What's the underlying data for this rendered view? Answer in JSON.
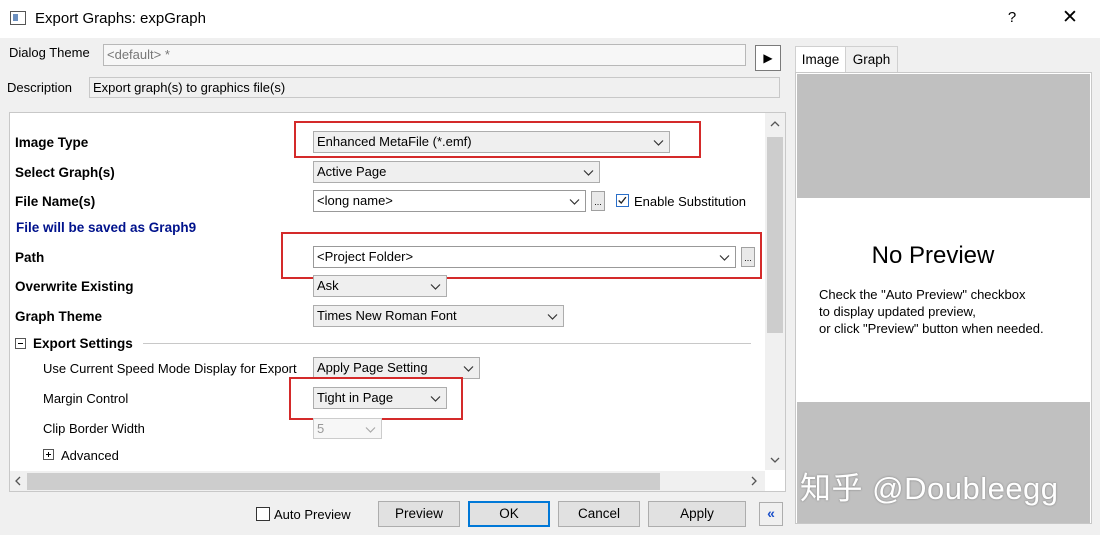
{
  "window": {
    "title": "Export Graphs: expGraph",
    "help_label": "?",
    "close_label": "✕"
  },
  "theme": {
    "label": "Dialog Theme",
    "value": "<default> *",
    "play_label": "▶"
  },
  "description": {
    "label": "Description",
    "value": "Export graph(s) to graphics file(s)"
  },
  "settings": {
    "image_type": {
      "label": "Image Type",
      "value": "Enhanced MetaFile (*.emf)"
    },
    "select_graphs": {
      "label": "Select Graph(s)",
      "value": "Active Page"
    },
    "file_name": {
      "label": "File Name(s)",
      "value": "<long name>",
      "browse_label": "...",
      "substitution_label": "Enable Substitution",
      "substitution_checked": true
    },
    "save_info": "File will be saved as Graph9",
    "path": {
      "label": "Path",
      "value": "<Project Folder>",
      "browse_label": "..."
    },
    "overwrite": {
      "label": "Overwrite Existing",
      "value": "Ask"
    },
    "graph_theme": {
      "label": "Graph Theme",
      "value": "Times New Roman Font"
    },
    "export_settings": {
      "label": "Export Settings",
      "speed_mode": {
        "label": "Use Current Speed Mode Display for Export",
        "value": "Apply Page Setting"
      },
      "margin_control": {
        "label": "Margin Control",
        "value": "Tight in Page"
      },
      "clip_border": {
        "label": "Clip Border Width",
        "value": "5"
      },
      "advanced_label": "Advanced"
    }
  },
  "footer": {
    "auto_preview_label": "Auto Preview",
    "auto_preview_checked": false,
    "preview_label": "Preview",
    "ok_label": "OK",
    "cancel_label": "Cancel",
    "apply_label": "Apply",
    "collapse_label": "«"
  },
  "preview": {
    "tabs": [
      {
        "label": "Image"
      },
      {
        "label": "Graph"
      }
    ],
    "active_tab": "Image",
    "title": "No Preview",
    "lines": [
      "Check the \"Auto Preview\" checkbox",
      "to display updated preview,",
      "or click \"Preview\" button when needed."
    ]
  },
  "watermark": "知乎 @Doubleegg",
  "colors": {
    "highlight_box": "#d42a2a",
    "info_text": "#00128c",
    "default_button_border": "#0078d7"
  },
  "icons": [
    "app-icon",
    "help-icon",
    "close-icon",
    "play-icon",
    "chevron-down-icon",
    "check-icon",
    "minus-box-icon",
    "plus-box-icon",
    "scroll-up-icon",
    "scroll-down-icon",
    "scroll-left-icon",
    "scroll-right-icon",
    "double-chevron-left-icon"
  ]
}
